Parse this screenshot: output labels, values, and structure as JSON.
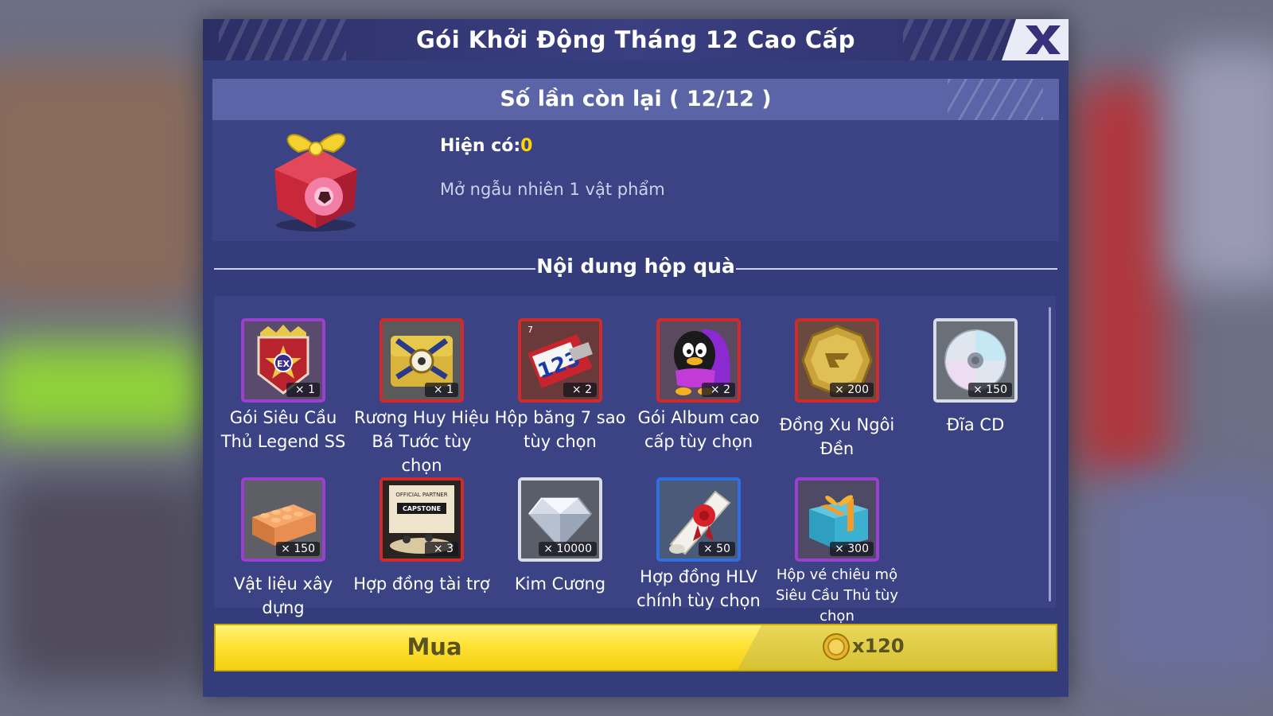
{
  "modal": {
    "title": "Gói Khởi Động Tháng 12 Cao Cấp",
    "close_label": "X",
    "remaining": "Số lần còn lại ( 12/12 )",
    "owned_label": "Hiện có:",
    "owned_value": "0",
    "description": "Mở ngẫu nhiên 1 vật phẩm",
    "section_title": "Nội dung hộp quà"
  },
  "items": [
    {
      "label": "Gói Siêu Cầu Thủ Legend SS",
      "qty": "× 1",
      "rarity": "purple",
      "icon": "legend-badge-icon"
    },
    {
      "label": "Rương Huy Hiệu Bá Tước tùy chọn",
      "qty": "× 1",
      "rarity": "red",
      "icon": "chest-icon"
    },
    {
      "label": "Hộp băng 7 sao tùy chọn",
      "qty": "× 2",
      "rarity": "red",
      "icon": "tape-box-icon"
    },
    {
      "label": "Gói Album cao cấp tùy chọn",
      "qty": "× 2",
      "rarity": "red",
      "icon": "penguin-bag-icon"
    },
    {
      "label": "Đồng Xu Ngôi Đền",
      "qty": "× 200",
      "rarity": "red",
      "icon": "temple-coin-icon"
    },
    {
      "label": "Đĩa CD",
      "qty": "× 150",
      "rarity": "silver",
      "icon": "cd-icon"
    },
    {
      "label": "Vật liệu xây dựng",
      "qty": "× 150",
      "rarity": "purple",
      "icon": "brick-icon"
    },
    {
      "label": "Hợp đồng tài trợ",
      "qty": "× 3",
      "rarity": "red",
      "icon": "sponsor-contract-icon",
      "badge_line1": "OFFICIAL PARTNER",
      "badge_line2": "CAPSTONE"
    },
    {
      "label": "Kim Cương",
      "qty": "× 10000",
      "rarity": "silver",
      "icon": "diamond-icon"
    },
    {
      "label": "Hợp đồng HLV chính tùy chọn",
      "qty": "× 50",
      "rarity": "blue",
      "icon": "scroll-contract-icon"
    },
    {
      "label": "Hộp vé chiêu mộ Siêu Cầu Thủ tùy chọn",
      "qty": "× 300",
      "rarity": "purple",
      "icon": "gift-box-icon"
    }
  ],
  "buy": {
    "label": "Mua",
    "price": "x120",
    "currency_icon": "gold-coin-icon"
  },
  "colors": {
    "panel": "#343c7c",
    "accent_yellow": "#ffe234",
    "owned_value": "#ffd400"
  }
}
